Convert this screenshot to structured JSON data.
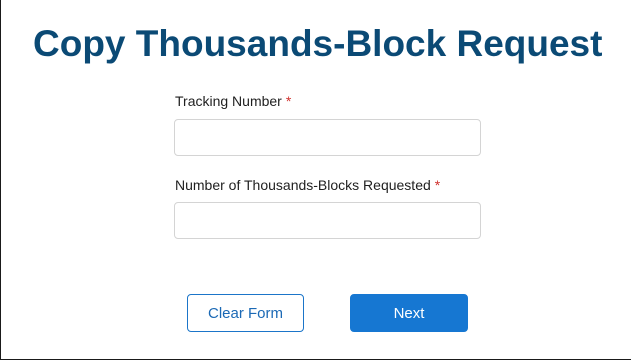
{
  "page": {
    "title": "Copy Thousands-Block Request"
  },
  "form": {
    "fields": [
      {
        "label": "Tracking Number",
        "required_marker": "*",
        "value": "",
        "placeholder": ""
      },
      {
        "label": "Number of Thousands-Blocks Requested",
        "required_marker": "*",
        "value": "",
        "placeholder": ""
      }
    ]
  },
  "actions": {
    "clear_label": "Clear Form",
    "next_label": "Next"
  },
  "colors": {
    "title": "#0b4a75",
    "required": "#d0312d",
    "primary": "#1677d2",
    "secondary_border": "#1b75c9"
  }
}
